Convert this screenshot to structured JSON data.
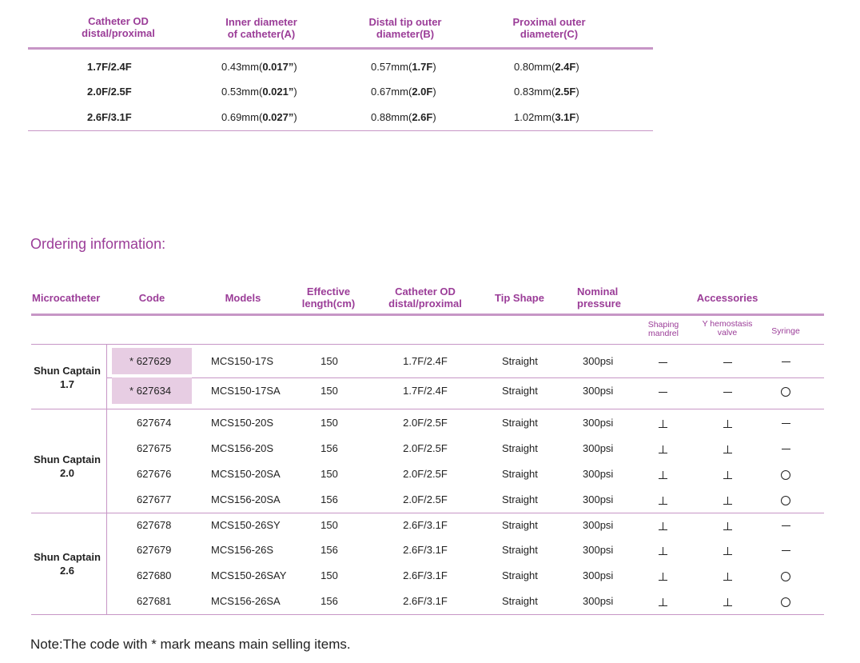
{
  "spec_table": {
    "headers": [
      "Catheter OD distal/proximal",
      "Inner diameter of catheter(A)",
      "Distal tip outer diameter(B)",
      "Proximal outer diameter(C)"
    ],
    "header_lines": [
      [
        "Catheter OD",
        "distal/proximal"
      ],
      [
        "Inner diameter",
        "of catheter(A)"
      ],
      [
        "Distal tip outer",
        "diameter(B)"
      ],
      [
        "Proximal outer",
        "diameter(C)"
      ]
    ],
    "rows": [
      {
        "od": "1.7F/2.4F",
        "inner_mm": "0.43mm",
        "inner_in": "0.017”",
        "distal_mm": "0.57mm",
        "distal_f": "1.7F",
        "prox_mm": "0.80mm",
        "prox_f": "2.4F"
      },
      {
        "od": "2.0F/2.5F",
        "inner_mm": "0.53mm",
        "inner_in": "0.021”",
        "distal_mm": "0.67mm",
        "distal_f": "2.0F",
        "prox_mm": "0.83mm",
        "prox_f": "2.5F"
      },
      {
        "od": "2.6F/3.1F",
        "inner_mm": "0.69mm",
        "inner_in": "0.027”",
        "distal_mm": "0.88mm",
        "distal_f": "2.6F",
        "prox_mm": "1.02mm",
        "prox_f": "3.1F"
      }
    ]
  },
  "ordering": {
    "title": "Ordering information:",
    "headers": {
      "microcatheter": "Microcatheter",
      "code": "Code",
      "models": "Models",
      "effective_1": "Effective",
      "effective_2": "length(cm)",
      "od_1": "Catheter OD",
      "od_2": "distal/proximal",
      "tip": "Tip Shape",
      "pressure_1": "Nominal",
      "pressure_2": "pressure",
      "accessories": "Accessories",
      "shaping_1": "Shaping",
      "shaping_2": "mandrel",
      "yvalve_1": "Y hemostasis",
      "yvalve_2": "valve",
      "syringe": "Syringe"
    },
    "groups": [
      {
        "line1": "Shun Captain",
        "line2": "1.7"
      },
      {
        "line1": "Shun Captain",
        "line2": "2.0"
      },
      {
        "line1": "Shun Captain",
        "line2": "2.6"
      }
    ],
    "rows": [
      {
        "code": "627629",
        "star": "*",
        "model": "MCS150-17S",
        "length": "150",
        "od": "1.7F/2.4F",
        "tip": "Straight",
        "pressure": "300psi",
        "syringe": "dash"
      },
      {
        "code": "627634",
        "star": "*",
        "model": "MCS150-17SA",
        "length": "150",
        "od": "1.7F/2.4F",
        "tip": "Straight",
        "pressure": "300psi",
        "syringe": "circle"
      },
      {
        "code": "627674",
        "star": "",
        "model": "MCS150-20S",
        "length": "150",
        "od": "2.0F/2.5F",
        "tip": "Straight",
        "pressure": "300psi",
        "syringe": "dash"
      },
      {
        "code": "627675",
        "star": "",
        "model": "MCS156-20S",
        "length": "156",
        "od": "2.0F/2.5F",
        "tip": "Straight",
        "pressure": "300psi",
        "syringe": "dash"
      },
      {
        "code": "627676",
        "star": "",
        "model": "MCS150-20SA",
        "length": "150",
        "od": "2.0F/2.5F",
        "tip": "Straight",
        "pressure": "300psi",
        "syringe": "circle"
      },
      {
        "code": "627677",
        "star": "",
        "model": "MCS156-20SA",
        "length": "156",
        "od": "2.0F/2.5F",
        "tip": "Straight",
        "pressure": "300psi",
        "syringe": "circle"
      },
      {
        "code": "627678",
        "star": "",
        "model": "MCS150-26SY",
        "length": "150",
        "od": "2.6F/3.1F",
        "tip": "Straight",
        "pressure": "300psi",
        "syringe": "dash"
      },
      {
        "code": "627679",
        "star": "",
        "model": "MCS156-26S",
        "length": "156",
        "od": "2.6F/3.1F",
        "tip": "Straight",
        "pressure": "300psi",
        "syringe": "dash"
      },
      {
        "code": "627680",
        "star": "",
        "model": "MCS150-26SAY",
        "length": "150",
        "od": "2.6F/3.1F",
        "tip": "Straight",
        "pressure": "300psi",
        "syringe": "circle"
      },
      {
        "code": "627681",
        "star": "",
        "model": "MCS156-26SA",
        "length": "156",
        "od": "2.6F/3.1F",
        "tip": "Straight",
        "pressure": "300psi",
        "syringe": "circle"
      }
    ],
    "note": "Note:The code with * mark means main selling items."
  },
  "colors": {
    "accent": "#9b3d98",
    "rule": "#c796c6",
    "highlight": "#e7cde3"
  }
}
